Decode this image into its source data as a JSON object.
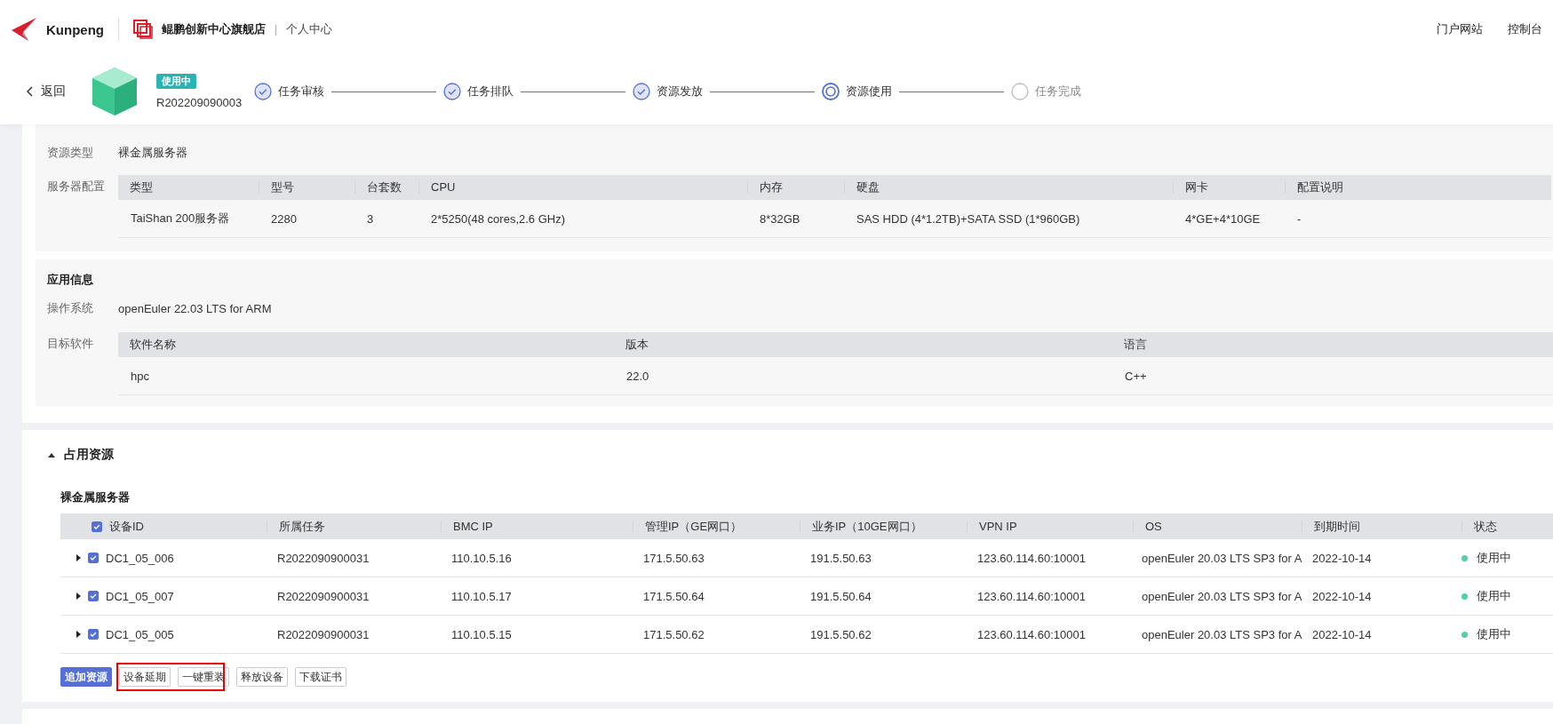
{
  "header": {
    "brand": "Kunpeng",
    "store": "鲲鹏创新中心旗舰店",
    "separator": "|",
    "section": "个人中心",
    "links": [
      "门户网站",
      "控制台"
    ]
  },
  "task": {
    "back": "返回",
    "status": "使用中",
    "id": "R202209090003",
    "steps": [
      {
        "label": "任务审核",
        "completed": true,
        "active": false
      },
      {
        "label": "任务排队",
        "completed": true,
        "active": false
      },
      {
        "label": "资源发放",
        "completed": true,
        "active": false
      },
      {
        "label": "资源使用",
        "completed": false,
        "active": true
      },
      {
        "label": "任务完成",
        "completed": false,
        "active": false
      }
    ]
  },
  "config": {
    "type_label": "资源类型",
    "type_value": "裸金属服务器",
    "server_label": "服务器配置",
    "columns": [
      "类型",
      "型号",
      "台套数",
      "CPU",
      "内存",
      "硬盘",
      "网卡",
      "配置说明"
    ],
    "rows": [
      [
        "TaiShan 200服务器",
        "2280",
        "3",
        "2*5250(48 cores,2.6 GHz)",
        "8*32GB",
        "SAS HDD (4*1.2TB)+SATA SSD (1*960GB)",
        "4*GE+4*10GE",
        "-"
      ]
    ]
  },
  "app": {
    "title": "应用信息",
    "os_label": "操作系统",
    "os": "openEuler 22.03 LTS for ARM",
    "software_label": "目标软件",
    "columns": [
      "软件名称",
      "版本",
      "语言"
    ],
    "rows": [
      [
        "hpc",
        "22.0",
        "C++"
      ]
    ]
  },
  "resources": {
    "title": "占用资源",
    "expanded": true,
    "subtitle": "裸金属服务器",
    "all_checked": true,
    "columns": [
      "设备ID",
      "所属任务",
      "BMC IP",
      "管理IP（GE网口）",
      "业务IP（10GE网口）",
      "VPN IP",
      "OS",
      "到期时间",
      "状态"
    ],
    "rows": [
      {
        "checked": true,
        "expanded": false,
        "cells": [
          "DC1_05_006",
          "R2022090900031",
          "110.10.5.16",
          "171.5.50.63",
          "191.5.50.63",
          "123.60.114.60:10001",
          "openEuler 20.03 LTS SP3 for A",
          "2022-10-14"
        ],
        "status": "使用中",
        "color": "#4cd3a4"
      },
      {
        "checked": true,
        "expanded": false,
        "cells": [
          "DC1_05_007",
          "R2022090900031",
          "110.10.5.17",
          "171.5.50.64",
          "191.5.50.64",
          "123.60.114.60:10001",
          "openEuler 20.03 LTS SP3 for A",
          "2022-10-14"
        ],
        "status": "使用中",
        "color": "#4cd3a4"
      },
      {
        "checked": true,
        "expanded": false,
        "cells": [
          "DC1_05_005",
          "R2022090900031",
          "110.10.5.15",
          "171.5.50.62",
          "191.5.50.62",
          "123.60.114.60:10001",
          "openEuler 20.03 LTS SP3 for A",
          "2022-10-14"
        ],
        "status": "使用中",
        "color": "#4cd3a4"
      }
    ],
    "buttons": [
      {
        "label": "追加资源",
        "primary": true
      },
      {
        "label": "设备延期",
        "primary": false
      },
      {
        "label": "一键重装",
        "primary": false
      },
      {
        "label": "释放设备",
        "primary": false
      },
      {
        "label": "下载证书",
        "primary": false
      }
    ]
  }
}
